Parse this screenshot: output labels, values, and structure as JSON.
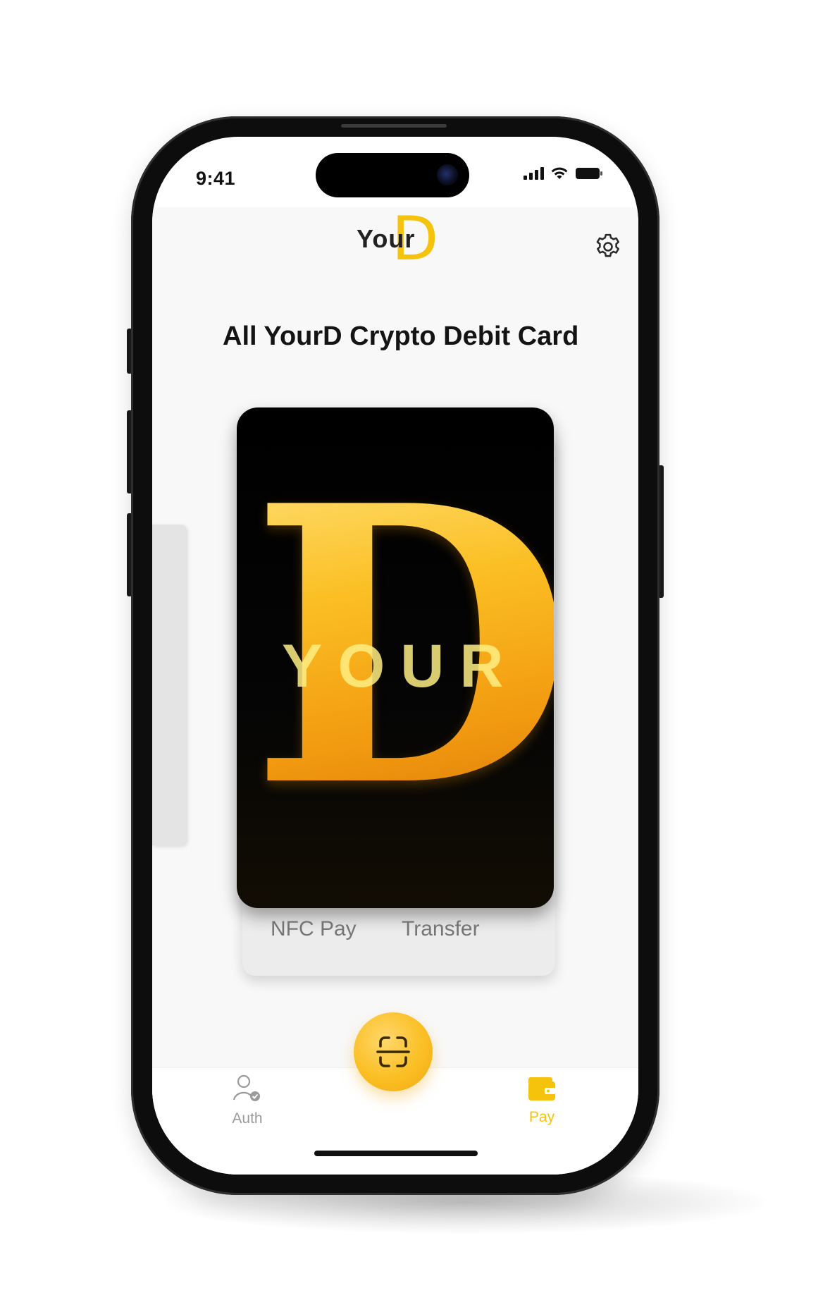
{
  "status_bar": {
    "time": "9:41"
  },
  "header": {
    "logo_word": "Your",
    "logo_letter": "D",
    "settings_icon": "gear-icon"
  },
  "main": {
    "title": "All YourD Crypto Debit Card",
    "card": {
      "overlay_text": "YOUR",
      "letter": "D"
    },
    "actions": [
      {
        "label": "NFC Pay"
      },
      {
        "label": "Transfer"
      }
    ]
  },
  "tab_bar": {
    "tabs": [
      {
        "label": "Auth",
        "icon": "user-check-icon",
        "active": false
      },
      {
        "label": "Pay",
        "icon": "wallet-icon",
        "active": true
      }
    ],
    "scan_icon": "scan-icon"
  },
  "colors": {
    "accent": "#f5c20c",
    "inactive": "#9a9a9a",
    "active": "#f5c20c"
  }
}
